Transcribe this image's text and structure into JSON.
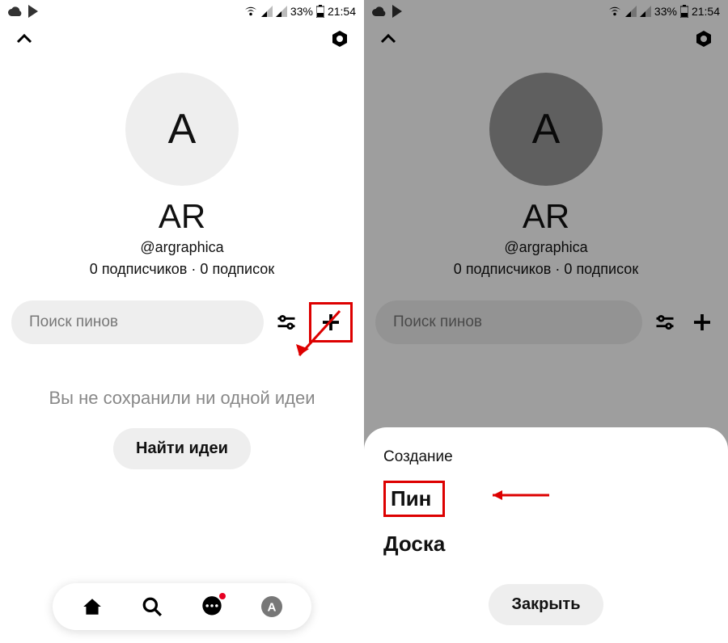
{
  "status": {
    "battery_pct": "33%",
    "time": "21:54"
  },
  "profile": {
    "avatar_letter": "A",
    "name": "AR",
    "handle": "@argraphica",
    "followers_count": "0",
    "followers_label": "подписчиков",
    "following_count": "0",
    "following_label": "подписок",
    "separator": "·"
  },
  "search": {
    "placeholder": "Поиск пинов"
  },
  "empty": {
    "message": "Вы не сохранили ни одной идеи",
    "cta": "Найти идеи"
  },
  "sheet": {
    "title": "Создание",
    "option_pin": "Пин",
    "option_board": "Доска",
    "close": "Закрыть"
  }
}
